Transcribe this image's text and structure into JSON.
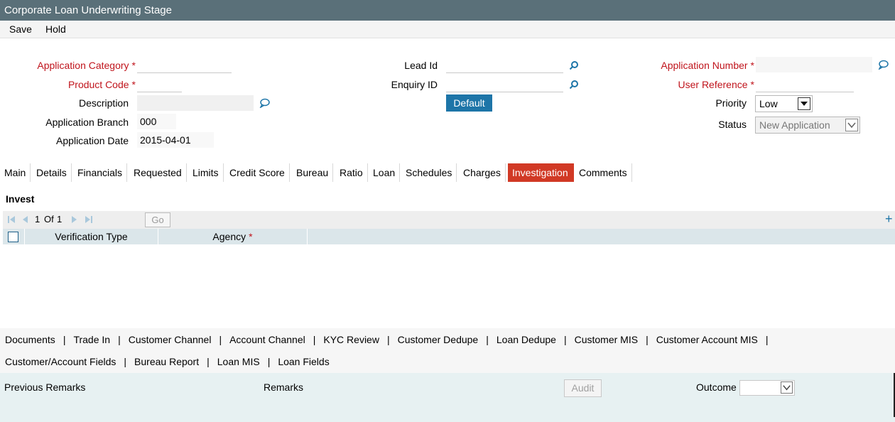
{
  "window": {
    "title": "Corporate Loan Underwriting Stage"
  },
  "menu": {
    "save": "Save",
    "hold": "Hold"
  },
  "form": {
    "application_category": {
      "label": "Application Category",
      "value": ""
    },
    "product_code": {
      "label": "Product Code",
      "value": ""
    },
    "description": {
      "label": "Description",
      "value": ""
    },
    "application_branch": {
      "label": "Application Branch",
      "value": "000"
    },
    "application_date": {
      "label": "Application Date",
      "value": "2015-04-01"
    },
    "lead_id": {
      "label": "Lead Id",
      "value": ""
    },
    "enquiry_id": {
      "label": "Enquiry ID",
      "value": ""
    },
    "default_button": "Default",
    "application_number": {
      "label": "Application Number",
      "value": ""
    },
    "user_reference": {
      "label": "User Reference",
      "value": ""
    },
    "priority": {
      "label": "Priority",
      "value": "Low"
    },
    "status": {
      "label": "Status",
      "value": "New Application"
    },
    "required_mark": "*"
  },
  "tabs": [
    "Main",
    "Details",
    "Financials",
    "Requested",
    "Limits",
    "Credit Score",
    "Bureau",
    "Ratio",
    "Loan",
    "Schedules",
    "Charges",
    "Investigation",
    "Comments"
  ],
  "active_tab": "Investigation",
  "invest": {
    "title": "Invest",
    "pager": {
      "current": "1",
      "of_label": "Of",
      "total": "1",
      "go": "Go"
    },
    "columns": [
      "Verification Type",
      "Agency"
    ]
  },
  "links_row1": [
    "Documents",
    "Trade In",
    "Customer Channel",
    "Account Channel",
    "KYC Review",
    "Customer Dedupe",
    "Loan Dedupe",
    "Customer MIS",
    "Customer Account MIS"
  ],
  "links_row2": [
    "Customer/Account Fields",
    "Bureau Report",
    "Loan MIS",
    "Loan Fields"
  ],
  "link_separator": "|",
  "footer": {
    "previous_remarks": "Previous Remarks",
    "remarks": "Remarks",
    "audit": "Audit",
    "outcome": "Outcome",
    "outcome_value": ""
  },
  "colors": {
    "titlebar": "#5a7079",
    "required": "#c0141c",
    "active_tab": "#d13925",
    "button": "#1d75a8",
    "grid_header": "#dbe6ea",
    "footer": "#e7f1f2"
  }
}
